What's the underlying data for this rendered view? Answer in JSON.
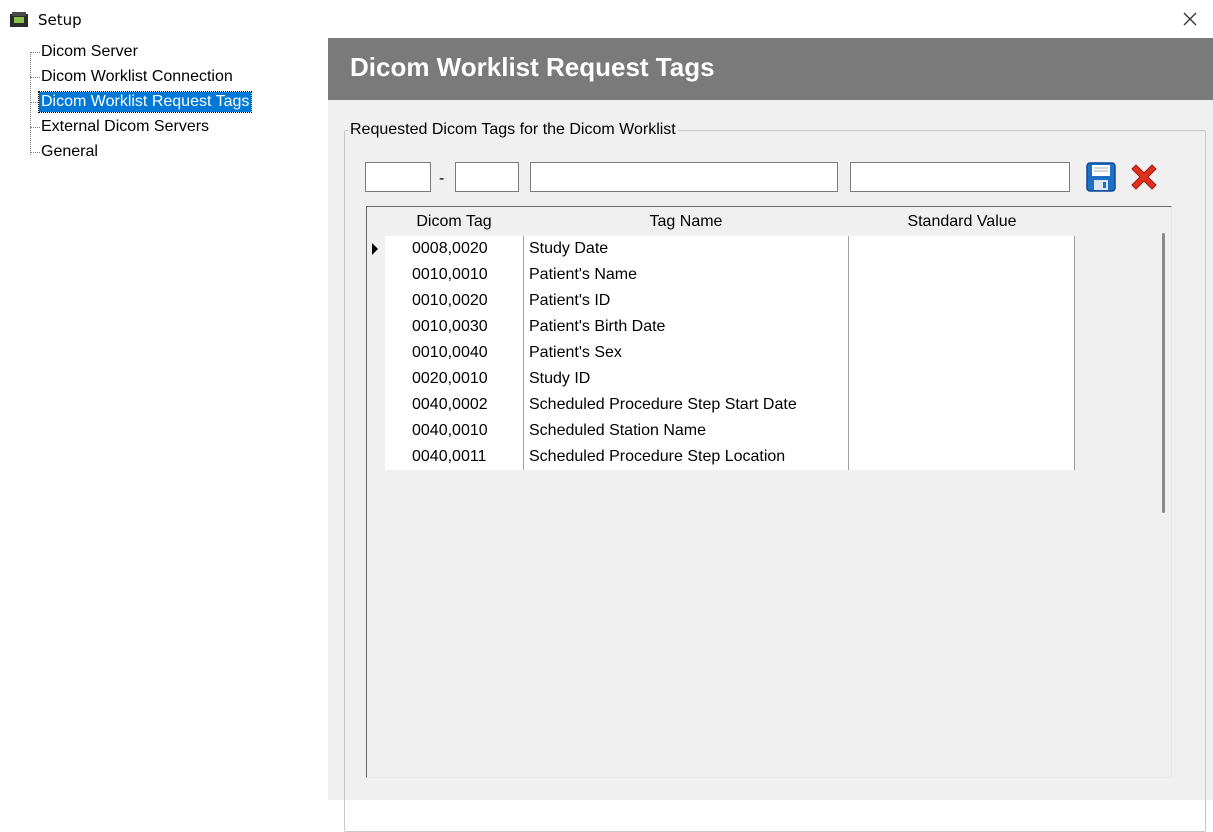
{
  "window": {
    "title": "Setup",
    "close_glyph": "✕"
  },
  "tree": {
    "items": [
      {
        "label": "Dicom Server"
      },
      {
        "label": "Dicom Worklist Connection"
      },
      {
        "label": "Dicom Worklist Request Tags"
      },
      {
        "label": "External Dicom Servers"
      },
      {
        "label": "General"
      }
    ],
    "selected_index": 2
  },
  "panel": {
    "title": "Dicom Worklist Request Tags",
    "group_label": "Requested Dicom Tags for the Dicom Worklist",
    "inputs": {
      "group": "",
      "dash": "-",
      "element": "",
      "tag_name": "",
      "standard_value": ""
    },
    "buttons": {
      "save_icon": "save-icon",
      "delete_icon": "delete-icon"
    }
  },
  "grid": {
    "columns": [
      "Dicom Tag",
      "Tag Name",
      "Standard Value"
    ],
    "rows": [
      {
        "tag": "0008,0020",
        "name": "Study Date",
        "value": ""
      },
      {
        "tag": "0010,0010",
        "name": "Patient's Name",
        "value": ""
      },
      {
        "tag": "0010,0020",
        "name": "Patient's ID",
        "value": ""
      },
      {
        "tag": "0010,0030",
        "name": "Patient's Birth Date",
        "value": ""
      },
      {
        "tag": "0010,0040",
        "name": "Patient's Sex",
        "value": ""
      },
      {
        "tag": "0020,0010",
        "name": "Study ID",
        "value": ""
      },
      {
        "tag": "0040,0002",
        "name": "Scheduled Procedure Step Start Date",
        "value": ""
      },
      {
        "tag": "0040,0010",
        "name": "Scheduled Station Name",
        "value": ""
      },
      {
        "tag": "0040,0011",
        "name": "Scheduled Procedure Step Location",
        "value": ""
      }
    ],
    "current_row_index": 0
  },
  "colors": {
    "header_bar": "#7a7a7a",
    "selection": "#0078d7",
    "delete_red": "#e0301e",
    "save_blue": "#1f6fc5"
  }
}
